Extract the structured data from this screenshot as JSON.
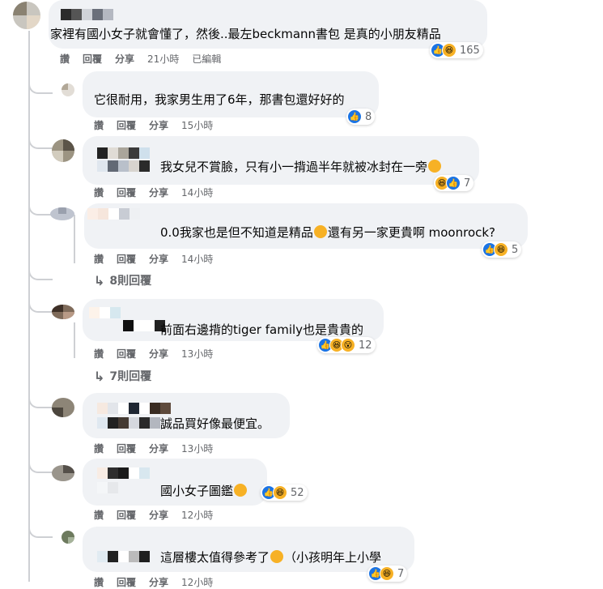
{
  "comments": [
    {
      "text": "家裡有國小女子就會懂了，然後..最左beckmann書包 是真的小朋友精品",
      "actions": [
        "讚",
        "回覆",
        "分享"
      ],
      "time": "21小時",
      "edited": "已編輯",
      "reaction_count": "165"
    },
    {
      "text": "它很耐用，我家男生用了6年，那書包還好好的",
      "actions": [
        "讚",
        "回覆",
        "分享"
      ],
      "time": "15小時",
      "reaction_count": "8"
    },
    {
      "text": "我女兒不賞臉，只有小一揹過半年就被冰封在一旁",
      "actions": [
        "讚",
        "回覆",
        "分享"
      ],
      "time": "14小時",
      "reaction_count": "7"
    },
    {
      "text": "0.0我家也是但不知道是精品",
      "text2": "還有另一家更貴啊 moonrock?",
      "actions": [
        "讚",
        "回覆",
        "分享"
      ],
      "time": "14小時",
      "reaction_count": "5",
      "replies": "8則回覆"
    },
    {
      "text": "前面右邊揹的tiger family也是貴貴的",
      "actions": [
        "讚",
        "回覆",
        "分享"
      ],
      "time": "13小時",
      "reaction_count": "12",
      "replies": "7則回覆"
    },
    {
      "text": "誠品買好像最便宜。",
      "actions": [
        "讚",
        "回覆",
        "分享"
      ],
      "time": "13小時"
    },
    {
      "text": "國小女子圖鑑",
      "actions": [
        "讚",
        "回覆",
        "分享"
      ],
      "time": "12小時",
      "reaction_count": "52"
    },
    {
      "text": "這層樓太值得參考了",
      "text2": "（小孩明年上小學",
      "actions": [
        "讚",
        "回覆",
        "分享"
      ],
      "time": "12小時",
      "reaction_count": "7"
    }
  ],
  "colors": {
    "bubble": "#f0f2f5",
    "like": "#1b74e4",
    "haha": "#f7b125",
    "meta": "#65676b"
  },
  "icons": [
    "like-reaction-icon",
    "haha-reaction-icon",
    "wow-reaction-icon",
    "reply-arrow-icon"
  ]
}
